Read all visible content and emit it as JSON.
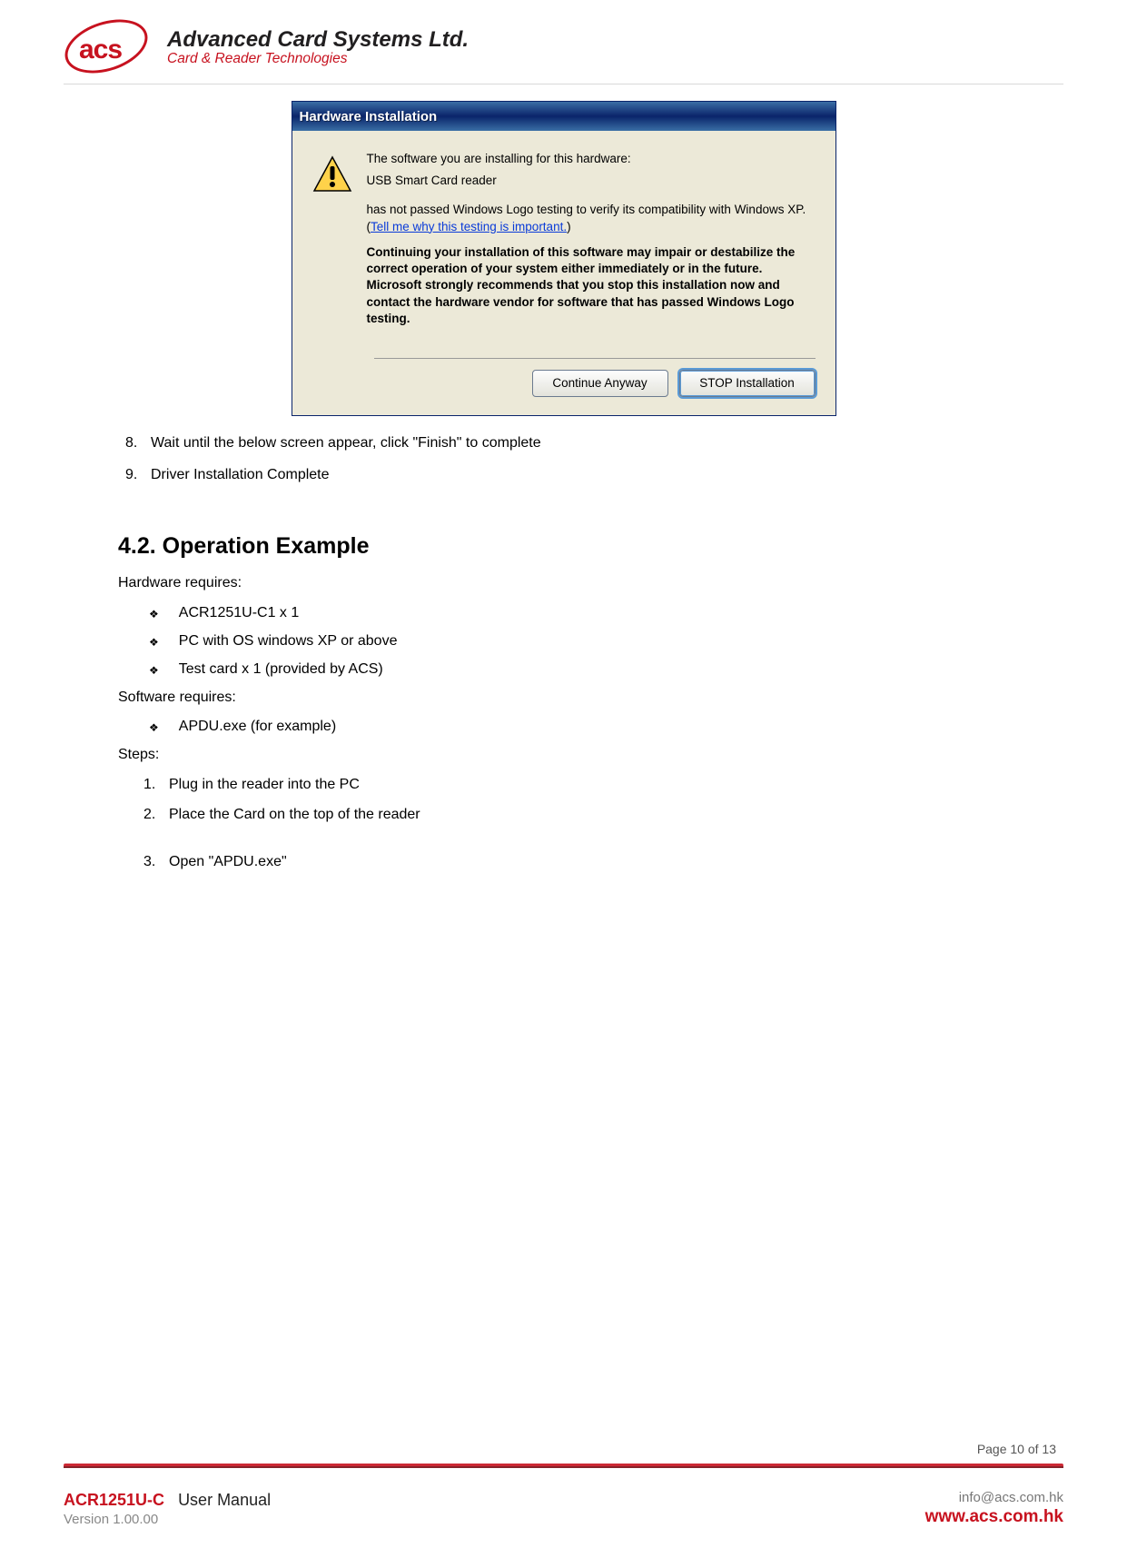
{
  "header": {
    "logo_text": "acs",
    "company_name": "Advanced Card Systems Ltd.",
    "tagline": "Card & Reader Technologies"
  },
  "dialog": {
    "title": "Hardware Installation",
    "line1": "The software you are installing for this hardware:",
    "device": "USB Smart Card reader",
    "line2a": "has not passed Windows Logo testing to verify its compatibility with Windows XP. (",
    "link": "Tell me why this testing is important.",
    "line2b": ")",
    "warning": "Continuing your installation of this software may impair or destabilize the correct operation of your system either immediately or in the future. Microsoft strongly recommends that you stop this installation now and contact the hardware vendor for software that has passed Windows Logo testing.",
    "btn_continue": "Continue Anyway",
    "btn_stop": "STOP Installation"
  },
  "list_after": {
    "i8_n": "8.",
    "i8": "Wait until the below screen appear, click \"Finish\" to complete",
    "i9_n": "9.",
    "i9": "Driver Installation Complete"
  },
  "section": {
    "heading": "4.2.   Operation Example",
    "hw_label": "Hardware requires:",
    "hw_items": {
      "a": "ACR1251U-C1 x 1",
      "b": "PC with OS windows XP or above",
      "c": "Test card x 1 (provided by ACS)"
    },
    "sw_label": "Software requires:",
    "sw_items": {
      "a": "APDU.exe (for example)"
    },
    "steps_label": "Steps:",
    "steps": {
      "n1": "1.",
      "s1": "Plug in the reader into the PC",
      "n2": "2.",
      "s2": "Place the Card on the top of the reader",
      "n3": "3.",
      "s3": "Open \"APDU.exe\""
    }
  },
  "footer": {
    "page_no": "Page 10 of 13",
    "left1_a": "ACR1251U-C",
    "left1_b": "User Manual",
    "left2": "Version 1.00.00",
    "right1": "info@acs.com.hk",
    "right2": "www.acs.com.hk"
  }
}
